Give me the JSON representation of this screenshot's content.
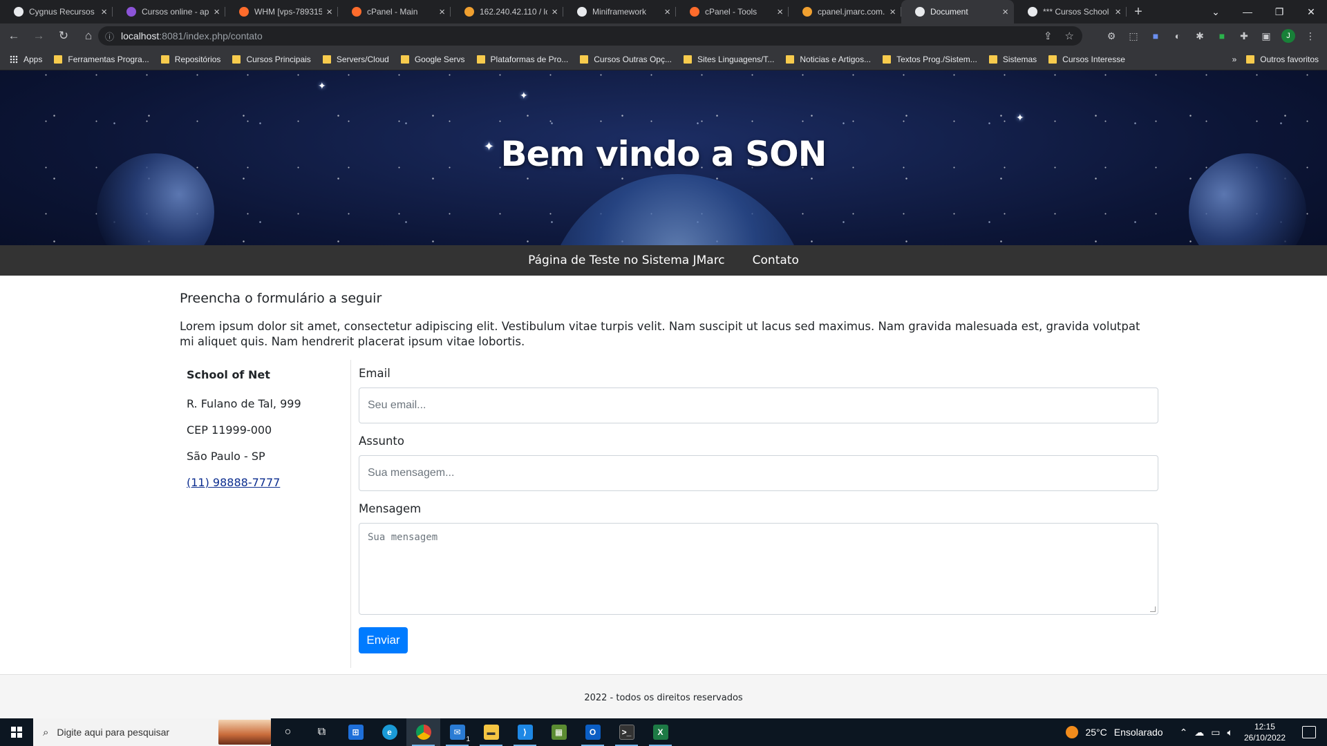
{
  "browser": {
    "tabs": [
      {
        "title": "Cygnus Recursos H",
        "favicon_color": "#e8eaed",
        "active": false
      },
      {
        "title": "Cursos online - ap",
        "favicon_color": "#8c54d8",
        "active": false
      },
      {
        "title": "WHM [vps-789315",
        "favicon_color": "#ff6c2c",
        "active": false
      },
      {
        "title": "cPanel - Main",
        "favicon_color": "#ff6c2c",
        "active": false
      },
      {
        "title": "162.240.42.110 / lo",
        "favicon_color": "#f0a030",
        "active": false
      },
      {
        "title": "Miniframework",
        "favicon_color": "#e8eaed",
        "active": false
      },
      {
        "title": "cPanel - Tools",
        "favicon_color": "#ff6c2c",
        "active": false
      },
      {
        "title": "cpanel.jmarc.com.b",
        "favicon_color": "#f0a030",
        "active": false
      },
      {
        "title": "Document",
        "favicon_color": "#e8eaed",
        "active": true
      },
      {
        "title": "*** Cursos School",
        "favicon_color": "#e8eaed",
        "active": false
      }
    ],
    "new_tab_label": "+",
    "url_host": "localhost",
    "url_path": ":8081/index.php/contato",
    "bookmarks": [
      {
        "label": "Apps",
        "type": "apps"
      },
      {
        "label": "Ferramentas Progra...",
        "type": "folder"
      },
      {
        "label": "Repositórios",
        "type": "folder"
      },
      {
        "label": "Cursos Principais",
        "type": "folder"
      },
      {
        "label": "Servers/Cloud",
        "type": "folder"
      },
      {
        "label": "Google Servs",
        "type": "folder"
      },
      {
        "label": "Plataformas de Pro...",
        "type": "folder"
      },
      {
        "label": "Cursos Outras Opç...",
        "type": "folder"
      },
      {
        "label": "Sites Linguagens/T...",
        "type": "folder"
      },
      {
        "label": "Noticias e Artigos...",
        "type": "folder"
      },
      {
        "label": "Textos Prog./Sistem...",
        "type": "folder"
      },
      {
        "label": "Sistemas",
        "type": "folder"
      },
      {
        "label": "Cursos Interesse",
        "type": "folder"
      }
    ],
    "bookmarks_more": "»",
    "other_bookmarks": "Outros favoritos",
    "profile_initial": "J"
  },
  "page": {
    "hero_title": "Bem vindo a SON",
    "nav": [
      {
        "label": "Página de Teste no Sistema JMarc"
      },
      {
        "label": "Contato"
      }
    ],
    "heading": "Preencha o formulário a seguir",
    "intro": "Lorem ipsum dolor sit amet, consectetur adipiscing elit. Vestibulum vitae turpis velit. Nam suscipit ut lacus sed maximus. Nam gravida malesuada est, gravida volutpat mi aliquet quis. Nam hendrerit placerat ipsum vitae lobortis.",
    "address": {
      "org": "School of Net",
      "street": "R. Fulano de Tal, 999",
      "cep": "CEP 11999-000",
      "city": "São Paulo - SP",
      "phone": "(11) 98888-7777"
    },
    "form": {
      "email_label": "Email",
      "email_placeholder": "Seu email...",
      "subject_label": "Assunto",
      "subject_placeholder": "Sua mensagem...",
      "message_label": "Mensagem",
      "message_placeholder": "Sua mensagem",
      "submit_label": "Enviar",
      "submit_color": "#007bff"
    },
    "footer": "2022 - todos os direitos reservados"
  },
  "taskbar": {
    "search_placeholder": "Digite aqui para pesquisar",
    "weather_temp": "25°C",
    "weather_desc": "Ensolarado",
    "time": "12:15",
    "date": "26/10/2022",
    "mail_badge": "1"
  }
}
